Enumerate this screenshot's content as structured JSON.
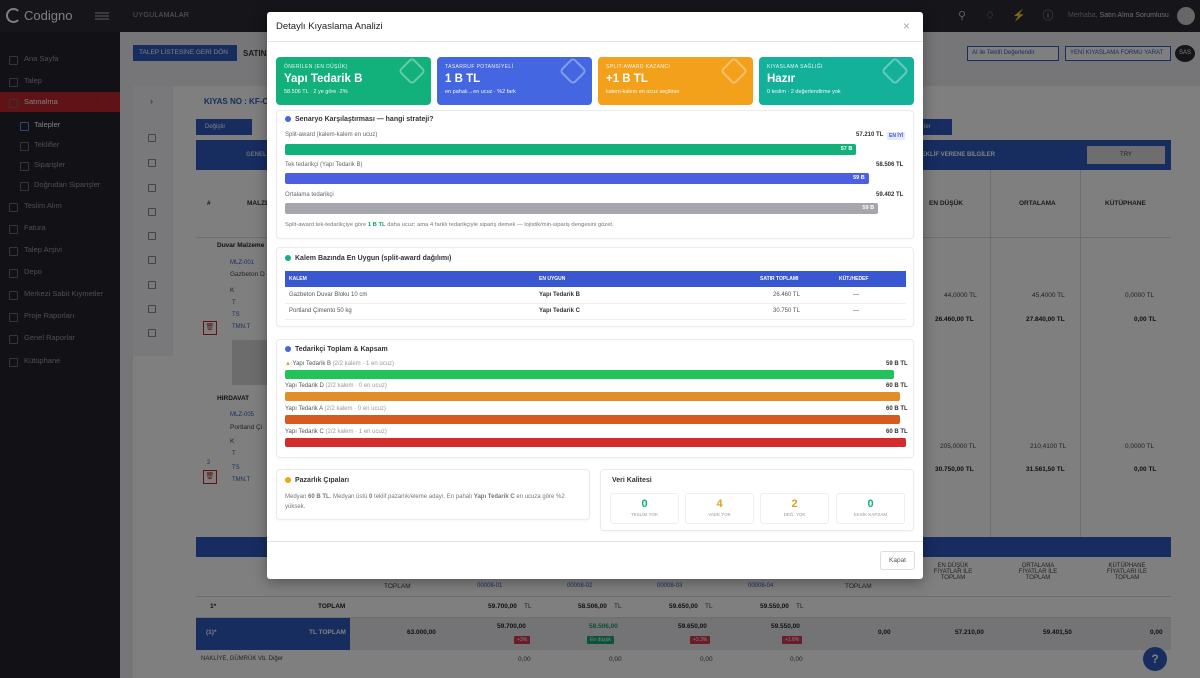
{
  "app": {
    "brand": "Codigno",
    "nav_label": "UYGULAMALAR",
    "user_prefix": "Merhaba,",
    "user_role": "Satın Alma Sorumlusu",
    "badge": "SAS"
  },
  "sidebar": {
    "items": [
      "Ana Sayfa",
      "Talep",
      "Satınalma",
      "Talepler",
      "Teklifler",
      "Siparişler",
      "Doğrudan Siparişler",
      "Teslim Alım",
      "Fatura",
      "Talep Arşivi",
      "Depo",
      "Merkezi Sabit Kıymetler",
      "Proje Raporları",
      "Genel Raporlar",
      "Kütüphane"
    ]
  },
  "page": {
    "back_label": "TALEP LİSTESİNE GERİ DÖN",
    "title": "SATINA",
    "ai_label": "AI ile Teklifi Değerlendir",
    "new_label": "YENİ KIYASLAMA FORMU YARAT",
    "kiyas_no": "KIYAS NO : KF-CA",
    "degistir": "Değiştir",
    "right_btn": "ler",
    "table": {
      "gen_label": "GENEL",
      "tekif_label": "TEKLİF VERENE BİLGİLER",
      "currency": "TRY",
      "cols": [
        "#",
        "MALZE",
        "EN DÜŞÜK",
        "ORTALAMA",
        "KÜTÜPHANE"
      ],
      "groups": [
        {
          "name": "Duvar Malzeme",
          "code": "MLZ-001",
          "item": "Gazbeton D",
          "k": "K",
          "t": "T",
          "ts": "TS",
          "tmn": "TMN.T",
          "min": "44,0000 TL",
          "avg": "45,4000 TL",
          "lib": "0,0000 TL",
          "min2": "26.460,00 TL",
          "avg2": "27.840,00 TL",
          "lib2": "0,00 TL"
        },
        {
          "name": "HIRDAVAT",
          "idx": "2",
          "code": "MLZ-005",
          "item": "Portland Çi",
          "k": "K",
          "t": "T",
          "ts": "TS",
          "tmn": "TMN.T",
          "min": "205,0000 TL",
          "avg": "210,4100 TL",
          "lib": "0,0000 TL",
          "min2": "30.750,00 TL",
          "avg2": "31.561,50 TL",
          "lib2": "0,00 TL"
        }
      ],
      "footer": {
        "offer_cols": [
          "00008-01",
          "00008-02",
          "00008-03",
          "00008-04"
        ],
        "toplam": "TOPLAM",
        "min_lbl": "EN DÜŞÜK FİYATLAR İLE TOPLAM",
        "avg_lbl": "ORTALAMA FİYATLAR İLE TOPLAM",
        "lib_lbl": "KÜTÜPHANE FİYATLARI İLE TOPLAM",
        "row1_idx": "1*",
        "row1_lbl": "TOPLAM",
        "row1_vals": [
          "59.700,00",
          "58.506,00",
          "59.650,00",
          "59.550,00"
        ],
        "tl": "TL",
        "row2_idx": "(1)*",
        "row2_lbl": "TL TOPLAM",
        "row2_first": "63.000,00",
        "row2_vals": [
          "59.700,00",
          "58.506,00",
          "59.650,00",
          "59.550,00"
        ],
        "row2_pills": [
          "+3%",
          "En düşük",
          "+3.3%",
          "+1.8%"
        ],
        "row2_tail": [
          "0,00",
          "57.210,00",
          "59.401,50",
          "0,00"
        ],
        "row3_lbl": "NAKLİYE, GÜMRÜK Vb. Diğer",
        "row3_vals": [
          "0,00",
          "0,00",
          "0,00",
          "0,00"
        ]
      }
    }
  },
  "modal": {
    "title": "Detaylı Kıyaslama Analizi",
    "close": "×",
    "cards": [
      {
        "label": "ÖNERİLEN (EN DÜŞÜK)",
        "value": "Yapı Tedarik B",
        "sub": "58.506 TL · 2 ye göre ·2%",
        "color": "#12b07a"
      },
      {
        "label": "TASARRUF POTANSİYELİ",
        "value": "1 B TL",
        "sub": "en pahalı→en ucuz · %2 fark",
        "color": "#4466e0"
      },
      {
        "label": "SPLIT-AWARD KAZANCI",
        "value": "+1 B TL",
        "sub": "kalem-kalem en ucuz seçilirse",
        "color": "#f3a01b"
      },
      {
        "label": "KIYASLAMA SAĞLIĞI",
        "value": "Hazır",
        "sub": "0 teslim · 2 değerlendirme yok",
        "color": "#13b09a"
      }
    ],
    "scenario": {
      "title": "Senaryo Karşılaştırması — hangi strateji?",
      "rows": [
        {
          "label": "Split-award (kalem-kalem en ucuz)",
          "value": "57.210 TL",
          "tag": "EN İYİ",
          "inner": "57 B",
          "color": "#12b07a",
          "pct": 0.92
        },
        {
          "label": "Tek tedarikçi (Yapı Tedarik B)",
          "value": "58.506 TL",
          "tag": "",
          "inner": "59 B",
          "color": "#4c5fe0",
          "pct": 0.94
        },
        {
          "label": "Ortalama tedarikçi",
          "value": "59.402 TL",
          "tag": "",
          "inner": "59 B",
          "color": "#a6a6ae",
          "pct": 0.955
        }
      ],
      "note_a": "Split-award tek-tedarikçiye göre ",
      "note_b": "1 B TL",
      "note_c": " daha ucuz; ama 4 farklı tedarikçiyle sipariş demek — lojistik/min-sipariş dengesini gözet."
    },
    "kalem": {
      "title": "Kalem Bazında En Uygun (split-award dağılımı)",
      "headers": [
        "KALEM",
        "EN UYGUN",
        "SATIR TOPLAMI",
        "KÜT./HEDEF"
      ],
      "rows": [
        {
          "kalem": "Gazbeton Duvar Bloku 10 cm",
          "uygun": "Yapı Tedarik B",
          "toplam": "26.460 TL",
          "hedef": "—"
        },
        {
          "kalem": "Portland Çimento 50 kg",
          "uygun": "Yapı Tedarik C",
          "toplam": "30.750 TL",
          "hedef": "—"
        }
      ]
    },
    "tedarikci": {
      "title": "Tedarikçi Toplam & Kapsam",
      "rows": [
        {
          "name": "Yapı Tedarik B",
          "detail": "(2/2 kalem · 1 en ucuz)",
          "value": "59 B TL",
          "color": "#22c35a",
          "pct": 0.98
        },
        {
          "name": "Yapı Tedarik D",
          "detail": "(2/2 kalem · 0 en ucuz)",
          "value": "60 B TL",
          "color": "#e08d2a",
          "pct": 0.99
        },
        {
          "name": "Yapı Tedarik A",
          "detail": "(2/2 kalem · 0 en ucuz)",
          "value": "60 B TL",
          "color": "#d85a22",
          "pct": 0.99
        },
        {
          "name": "Yapı Tedarik C",
          "detail": "(2/2 kalem · 1 en ucuz)",
          "value": "60 B TL",
          "color": "#d42c2c",
          "pct": 1.0
        }
      ]
    },
    "pazarlik": {
      "title": "Pazarlık Çıpaları",
      "t1": "Medyan ",
      "t2": "60 B TL",
      "t3": ". Medyan üstü ",
      "t4": "0",
      "t5": " teklif pazarlık/eleme adayı. En pahalı ",
      "t6": "Yapı Tedarik C",
      "t7": " en ucuza göre %2 yüksek."
    },
    "veri": {
      "title": "Veri Kalitesi",
      "boxes": [
        {
          "n": "0",
          "l": "TESLİM YOK",
          "color": "#12b07a"
        },
        {
          "n": "4",
          "l": "VADE YOK",
          "color": "#e0a020"
        },
        {
          "n": "2",
          "l": "DEĞ. YOK",
          "color": "#e0a020"
        },
        {
          "n": "0",
          "l": "EKSİK KAPSAM",
          "color": "#12b07a"
        }
      ]
    },
    "kapat": "Kapat"
  }
}
